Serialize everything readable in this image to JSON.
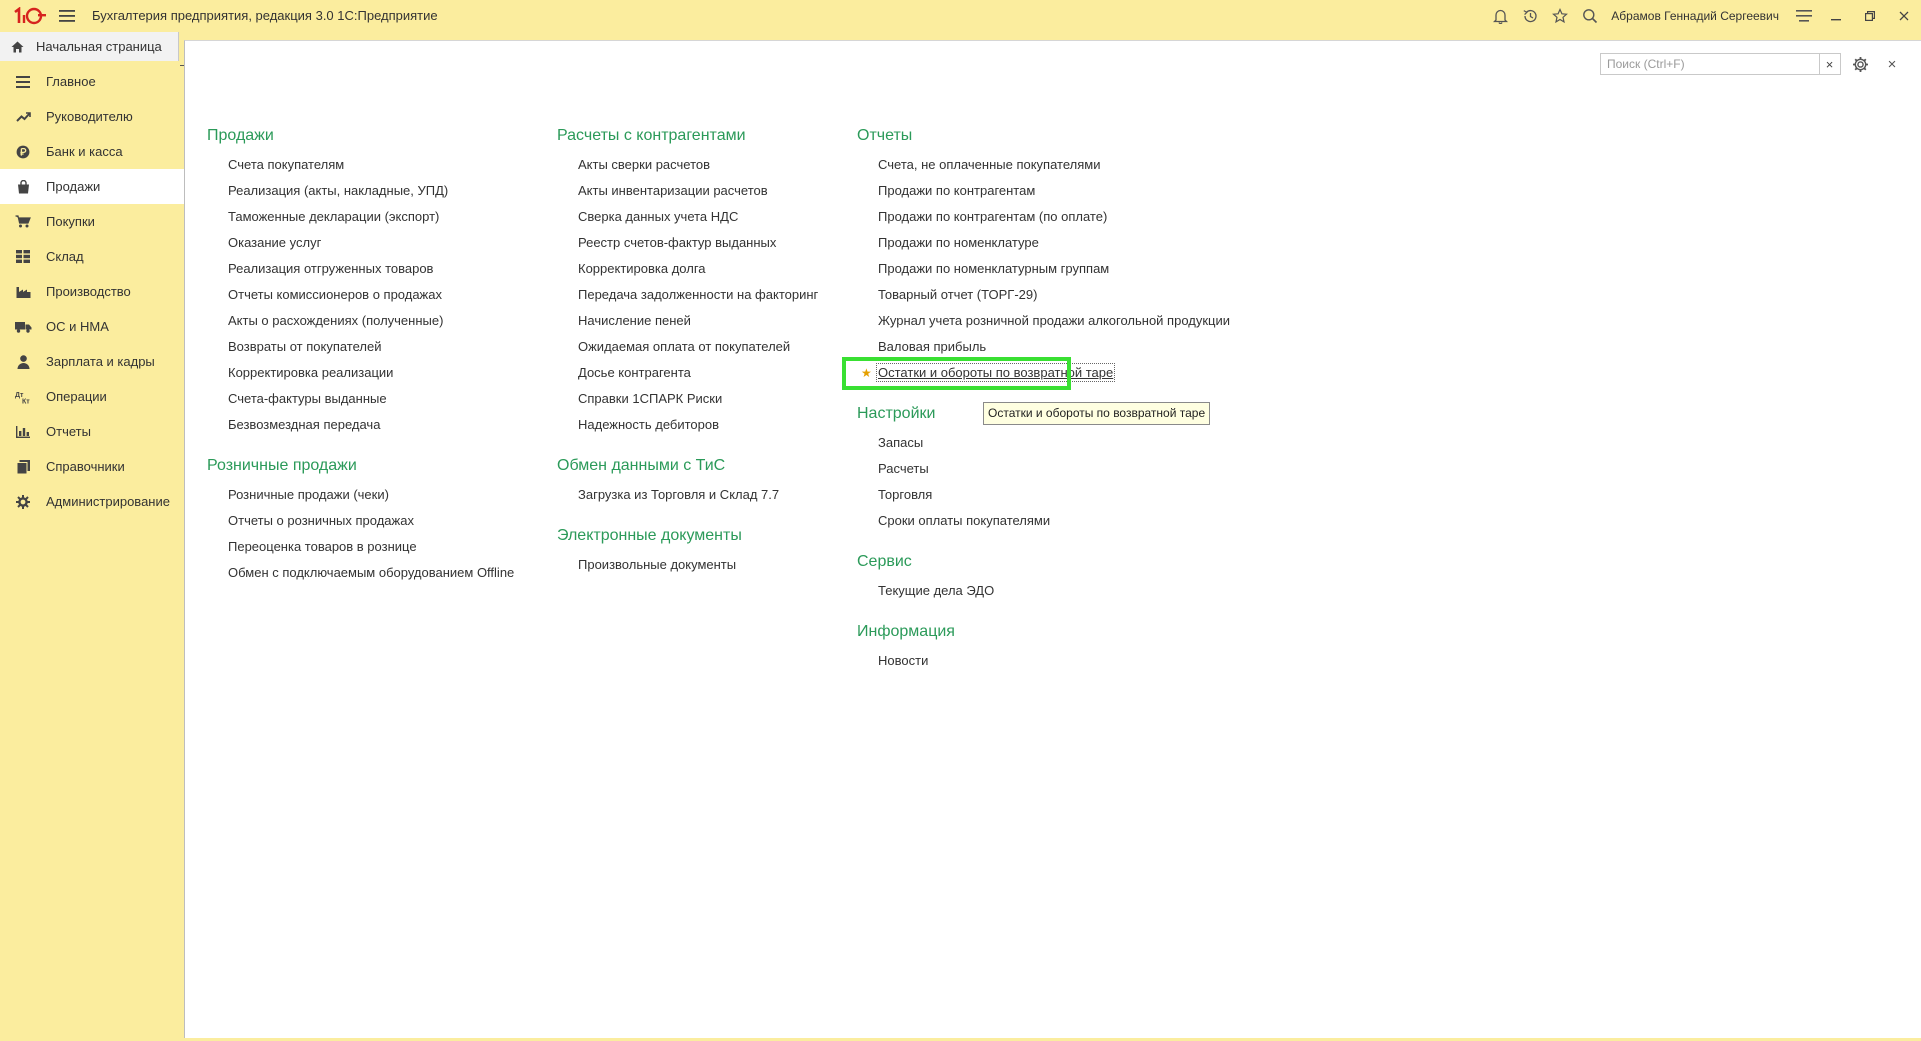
{
  "app": {
    "title": "Бухгалтерия предприятия, редакция 3.0 1С:Предприятие",
    "user_name": "Абрамов Геннадий Сергеевич"
  },
  "home_tab": {
    "label": "Начальная страница"
  },
  "sidebar": {
    "items": [
      {
        "label": "Главное",
        "icon": "menu-lines-icon"
      },
      {
        "label": "Руководителю",
        "icon": "trend-up-icon"
      },
      {
        "label": "Банк и касса",
        "icon": "coin-icon"
      },
      {
        "label": "Продажи",
        "icon": "shopping-bag-icon",
        "active": true
      },
      {
        "label": "Покупки",
        "icon": "cart-icon"
      },
      {
        "label": "Склад",
        "icon": "warehouse-grid-icon"
      },
      {
        "label": "Производство",
        "icon": "factory-icon"
      },
      {
        "label": "ОС и НМА",
        "icon": "truck-icon"
      },
      {
        "label": "Зарплата и кадры",
        "icon": "person-icon"
      },
      {
        "label": "Операции",
        "icon": "debit-credit-icon"
      },
      {
        "label": "Отчеты",
        "icon": "bar-chart-icon"
      },
      {
        "label": "Справочники",
        "icon": "book-icon"
      },
      {
        "label": "Администрирование",
        "icon": "gear-icon"
      }
    ]
  },
  "search": {
    "placeholder": "Поиск (Ctrl+F)",
    "clear_label": "×"
  },
  "close_label": "×",
  "columns": [
    {
      "sections": [
        {
          "title": "Продажи",
          "links": [
            "Счета покупателям",
            "Реализация (акты, накладные, УПД)",
            "Таможенные декларации (экспорт)",
            "Оказание услуг",
            "Реализация отгруженных товаров",
            "Отчеты комиссионеров о продажах",
            "Акты о расхождениях (полученные)",
            "Возвраты от покупателей",
            "Корректировка реализации",
            "Счета-фактуры выданные",
            "Безвозмездная передача"
          ]
        },
        {
          "title": "Розничные продажи",
          "links": [
            "Розничные продажи (чеки)",
            "Отчеты о розничных продажах",
            "Переоценка товаров в рознице",
            "Обмен с подключаемым оборудованием Offline"
          ]
        }
      ]
    },
    {
      "sections": [
        {
          "title": "Расчеты с контрагентами",
          "links": [
            "Акты сверки расчетов",
            "Акты инвентаризации расчетов",
            "Сверка данных учета НДС",
            "Реестр счетов-фактур выданных",
            "Корректировка долга",
            "Передача задолженности на факторинг",
            "Начисление пеней",
            "Ожидаемая оплата от покупателей",
            "Досье контрагента",
            "Справки 1СПАРК Риски",
            "Надежность дебиторов"
          ]
        },
        {
          "title": "Обмен данными с ТиС",
          "links": [
            "Загрузка из Торговля и Склад 7.7"
          ]
        },
        {
          "title": "Электронные документы",
          "links": [
            "Произвольные документы"
          ]
        }
      ]
    },
    {
      "sections": [
        {
          "title": "Отчеты",
          "links": [
            "Счета, не оплаченные покупателями",
            "Продажи по контрагентам",
            "Продажи по контрагентам (по оплате)",
            "Продажи по номенклатуре",
            "Продажи по номенклатурным группам",
            "Товарный отчет (ТОРГ-29)",
            "Журнал учета розничной продажи алкогольной продукции",
            "Валовая прибыль",
            "Остатки и обороты по возвратной таре"
          ]
        },
        {
          "title": "Настройки",
          "links": [
            "Запасы",
            "Расчеты",
            "Торговля",
            "Сроки оплаты покупателями"
          ]
        },
        {
          "title": "Сервис",
          "links": [
            "Текущие дела ЭДО"
          ]
        },
        {
          "title": "Информация",
          "links": [
            "Новости"
          ]
        }
      ]
    }
  ],
  "highlighted_link": {
    "column": 2,
    "section": 0,
    "link": 8,
    "starred": true
  },
  "tooltip": {
    "text": "Остатки и обороты по возвратной таре"
  }
}
